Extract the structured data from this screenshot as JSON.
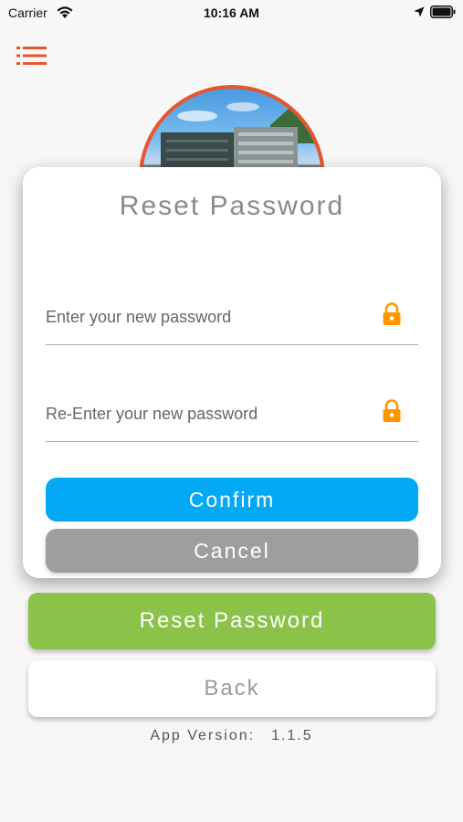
{
  "status_bar": {
    "carrier": "Carrier",
    "time": "10:16 AM"
  },
  "header": {
    "menu_icon": "list-menu-icon",
    "accent": "#e8552b"
  },
  "dialog": {
    "title": "Reset Password",
    "new_password": {
      "placeholder": "Enter your new password",
      "value": ""
    },
    "reenter_password": {
      "placeholder": "Re-Enter your new password",
      "value": ""
    },
    "confirm_label": "Confirm",
    "cancel_label": "Cancel",
    "lock_color": "#ff9800"
  },
  "page": {
    "reset_button_label": "Reset Password",
    "back_button_label": "Back",
    "version_label": "App Version:",
    "version_number": "1.1.5"
  },
  "colors": {
    "confirm": "#03a9f4",
    "cancel": "#9e9e9e",
    "reset": "#8bc34a"
  }
}
